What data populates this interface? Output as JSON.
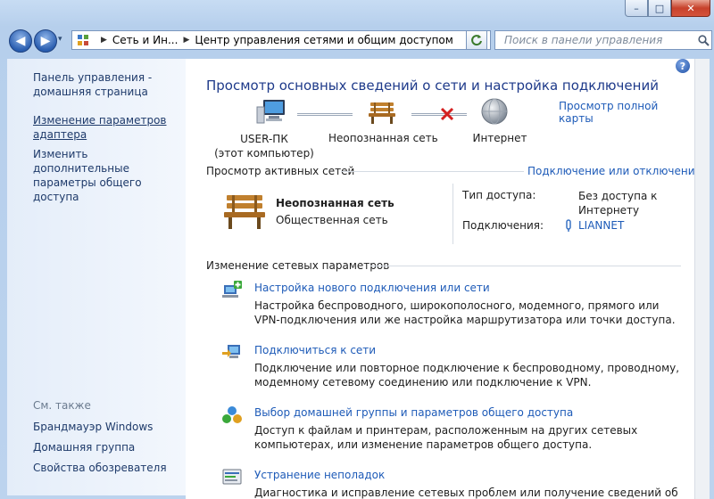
{
  "window": {
    "minimize_glyph": "–",
    "maximize_glyph": "□",
    "close_glyph": "✕"
  },
  "navigation": {
    "back_glyph": "◀",
    "forward_glyph": "▶",
    "recent_glyph": "▾",
    "breadcrumb": [
      "Сеть и Ин...",
      "Центр управления сетями и общим доступом"
    ],
    "search_placeholder": "Поиск в панели управления"
  },
  "sidebar": {
    "home_link": "Панель управления - домашняя страница",
    "adapter_link": "Изменение параметров адаптера",
    "sharing_link": "Изменить дополнительные параметры общего доступа",
    "see_also_title": "См. также",
    "see_also": [
      "Брандмауэр Windows",
      "Домашняя группа",
      "Свойства обозревателя"
    ]
  },
  "main": {
    "title": "Просмотр основных сведений о сети и настройка подключений",
    "full_map_link": "Просмотр полной карты",
    "map": {
      "computer_name": "USER-ПК",
      "computer_sub": "(этот компьютер)",
      "network": "Неопознанная сеть",
      "internet": "Интернет"
    },
    "active_networks": {
      "heading": "Просмотр активных сетей",
      "connect_link": "Подключение или отключение",
      "network_name": "Неопознанная сеть",
      "network_type": "Общественная сеть",
      "access_label": "Тип доступа:",
      "access_value": "Без доступа к Интернету",
      "connections_label": "Подключения:",
      "connection_value": "LIANNET"
    },
    "change_settings": {
      "heading": "Изменение сетевых параметров",
      "tasks": [
        {
          "title": "Настройка нового подключения или сети",
          "desc": "Настройка беспроводного, широкополосного, модемного, прямого или VPN-подключения или же настройка маршрутизатора или точки доступа."
        },
        {
          "title": "Подключиться к сети",
          "desc": "Подключение или повторное подключение к беспроводному, проводному, модемному сетевому соединению или подключение к VPN."
        },
        {
          "title": "Выбор домашней группы и параметров общего доступа",
          "desc": "Доступ к файлам и принтерам, расположенным на других сетевых компьютерах, или изменение параметров общего доступа."
        },
        {
          "title": "Устранение неполадок",
          "desc": "Диагностика и исправление сетевых проблем или получение сведений об"
        }
      ]
    }
  },
  "help": {
    "glyph": "?"
  },
  "colors": {
    "link": "#1e5bb8",
    "title": "#1e3a8a",
    "error": "#d42020"
  }
}
